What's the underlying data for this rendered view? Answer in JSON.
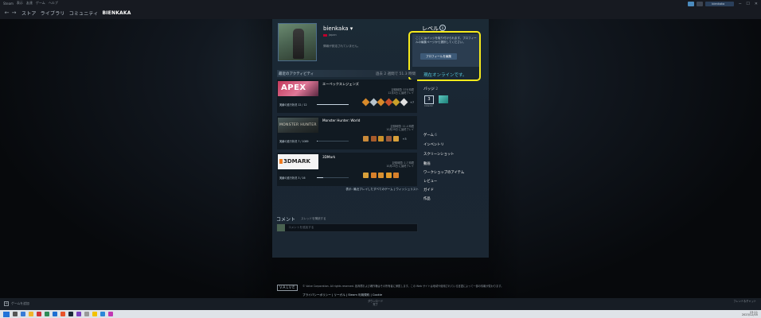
{
  "menubar": [
    "Steam",
    "表示",
    "友達",
    "ゲーム",
    "ヘルプ"
  ],
  "nav": {
    "back": "←",
    "forward": "→",
    "links": [
      "ストア",
      "ライブラリ",
      "コミュニティ",
      "BIENKAKA"
    ]
  },
  "topright": {
    "user": "bienkaka",
    "min": "─",
    "max": "☐",
    "close": "✕"
  },
  "profile": {
    "name": "bienkaka ▾",
    "country": "Japan",
    "summary": "情報が設定されていません。"
  },
  "level": {
    "title": "レベル",
    "value": "0",
    "tip": "ここにはバッジを取り付けられます。プロフィールの編集ページから選択してください。",
    "edit_button": "プロフィールを編集"
  },
  "online_status": "現在オンラインです。",
  "activity": {
    "title": "最近のアクティビティ",
    "hours": "過去 2 週間で 51.3 時間",
    "games": [
      {
        "caption": "APEX",
        "name": "エーペックスレジェンズ",
        "meta1": "記録時間: 576 時間",
        "meta2": "12月4日 に最終プレイ",
        "progress_label": "実績の進行状況  12 / 12",
        "progress": 1.0,
        "achievements": [
          {
            "color": "#d88a2a"
          },
          {
            "color": "#b8c4cc"
          },
          {
            "color": "#d88a2a"
          },
          {
            "color": "#c9502a"
          },
          {
            "color": "#c9a02a"
          },
          {
            "color": "#e0e0e0"
          }
        ],
        "more": "+7"
      },
      {
        "caption": "MONSTER HUNTER",
        "name": "Monster Hunter: World",
        "meta1": "記録時間: 11.4 時間",
        "meta2": "10月29日 に最終プレイ",
        "progress_label": "実績の進行状況  7 / 1089",
        "progress": 0.006,
        "achievements": [
          {
            "color": "#c98a3a"
          },
          {
            "color": "#a65a2a"
          },
          {
            "color": "#c9902a"
          },
          {
            "color": "#9a5a3a"
          },
          {
            "color": "#d8a03a"
          }
        ],
        "more": "+3"
      },
      {
        "caption": "3DMARK",
        "name": "3DMark",
        "meta1": "記録時間: 1.7 時間",
        "meta2": "10月25日 に最終プレイ",
        "progress_label": "実績の進行状況  3 / 16",
        "progress": 0.19,
        "achievements": [
          {
            "color": "#d8a03a"
          },
          {
            "color": "#d8802a"
          },
          {
            "color": "#d89030"
          },
          {
            "color": "#e09a2a"
          },
          {
            "color": "#d8802a"
          }
        ],
        "more": ""
      }
    ],
    "links": "表示:  最近プレイしたすべてのゲーム  |  ウィッシュリスト"
  },
  "right": {
    "badges_title": "バッジ",
    "badges_count": "2",
    "badge_level": "3",
    "badge_sub": "Collector",
    "links": [
      {
        "label": "ゲーム",
        "count": "6"
      },
      {
        "label": "インベントリ",
        "count": ""
      },
      {
        "label": "スクリーンショット",
        "count": ""
      },
      {
        "label": "動画",
        "count": ""
      },
      {
        "label": "ワークショップのアイテム",
        "count": ""
      },
      {
        "label": "レビュー",
        "count": ""
      },
      {
        "label": "ガイド",
        "count": ""
      },
      {
        "label": "作品",
        "count": ""
      }
    ]
  },
  "comments": {
    "title": "コメント",
    "sub": "スレッドを購読する",
    "placeholder": "コメントを追加する"
  },
  "footer": {
    "valve": "VALVE",
    "text": "© Valve Corporation. All rights reserved. 各商標および著作権はその所有者に帰属します。この Web サイトは地域や使用されている言語によって一部の情報が変わります。",
    "links": "プライバシーポリシー  |  リーガル  |  Steam 利用規約  |  Cookie"
  },
  "steambar": {
    "add_game": "ゲームを追加",
    "downloads_title": "ダウンロード",
    "downloads_sub": "完了",
    "friends": "フレンド＆チャット"
  },
  "taskbar": {
    "time": "23:11",
    "date": "2023/12/05"
  }
}
